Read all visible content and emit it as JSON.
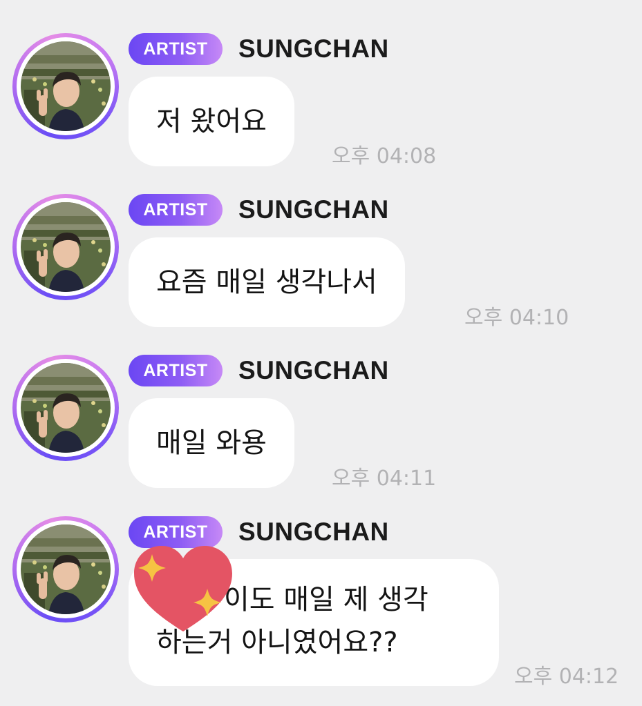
{
  "messages": [
    {
      "badge": "ARTIST",
      "sender": "SUNGCHAN",
      "text": "저 왔어요",
      "time": "오후 04:08"
    },
    {
      "badge": "ARTIST",
      "sender": "SUNGCHAN",
      "text": "요즘 매일 생각나서",
      "time": "오후 04:10"
    },
    {
      "badge": "ARTIST",
      "sender": "SUNGCHAN",
      "text": "매일 와용",
      "time": "오후 04:11"
    },
    {
      "badge": "ARTIST",
      "sender": "SUNGCHAN",
      "text_line1": "이도 매일 제 생각",
      "text_line2": "하는거 아니였어요??",
      "time": "오후 04:12",
      "sticker": "sparkling-heart"
    }
  ],
  "colors": {
    "background": "#efeff0",
    "badge_start": "#6b47f3",
    "badge_end": "#c689f6",
    "bubble": "#ffffff",
    "timestamp": "#b2b2b4",
    "heart": "#e45464",
    "sparkle": "#f6c343"
  }
}
